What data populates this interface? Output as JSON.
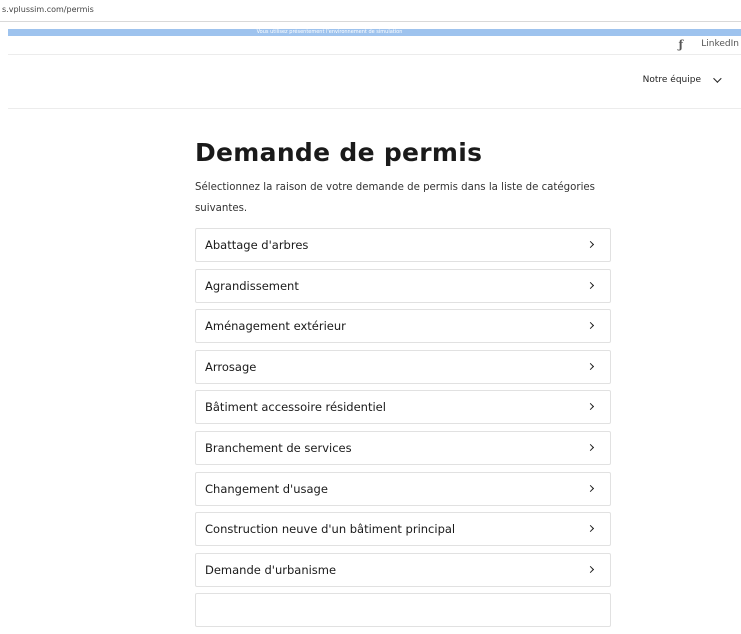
{
  "browser": {
    "url": "s.vplussim.com/permis"
  },
  "banner": {
    "text": "Vous utilisez présentement l'environnement de simulation"
  },
  "social": {
    "facebook_icon": "facebook-icon",
    "linkedin_label": "LinkedIn"
  },
  "nav": {
    "team_label": "Notre équipe",
    "team_icon": "chevron-down-icon"
  },
  "main": {
    "title": "Demande de permis",
    "intro": "Sélectionnez la raison de votre demande de permis dans la liste de catégories suivantes.",
    "categories": [
      {
        "label": "Abattage d'arbres"
      },
      {
        "label": "Agrandissement"
      },
      {
        "label": "Aménagement extérieur"
      },
      {
        "label": "Arrosage"
      },
      {
        "label": "Bâtiment accessoire résidentiel"
      },
      {
        "label": "Branchement de services"
      },
      {
        "label": "Changement d'usage"
      },
      {
        "label": "Construction neuve d'un bâtiment principal"
      },
      {
        "label": "Demande d'urbanisme"
      },
      {
        "label": ""
      }
    ],
    "item_icon": "chevron-right-icon"
  },
  "colors": {
    "banner": "#9ec3ee",
    "border": "#e1e1e1",
    "text": "#1a1a1a"
  }
}
